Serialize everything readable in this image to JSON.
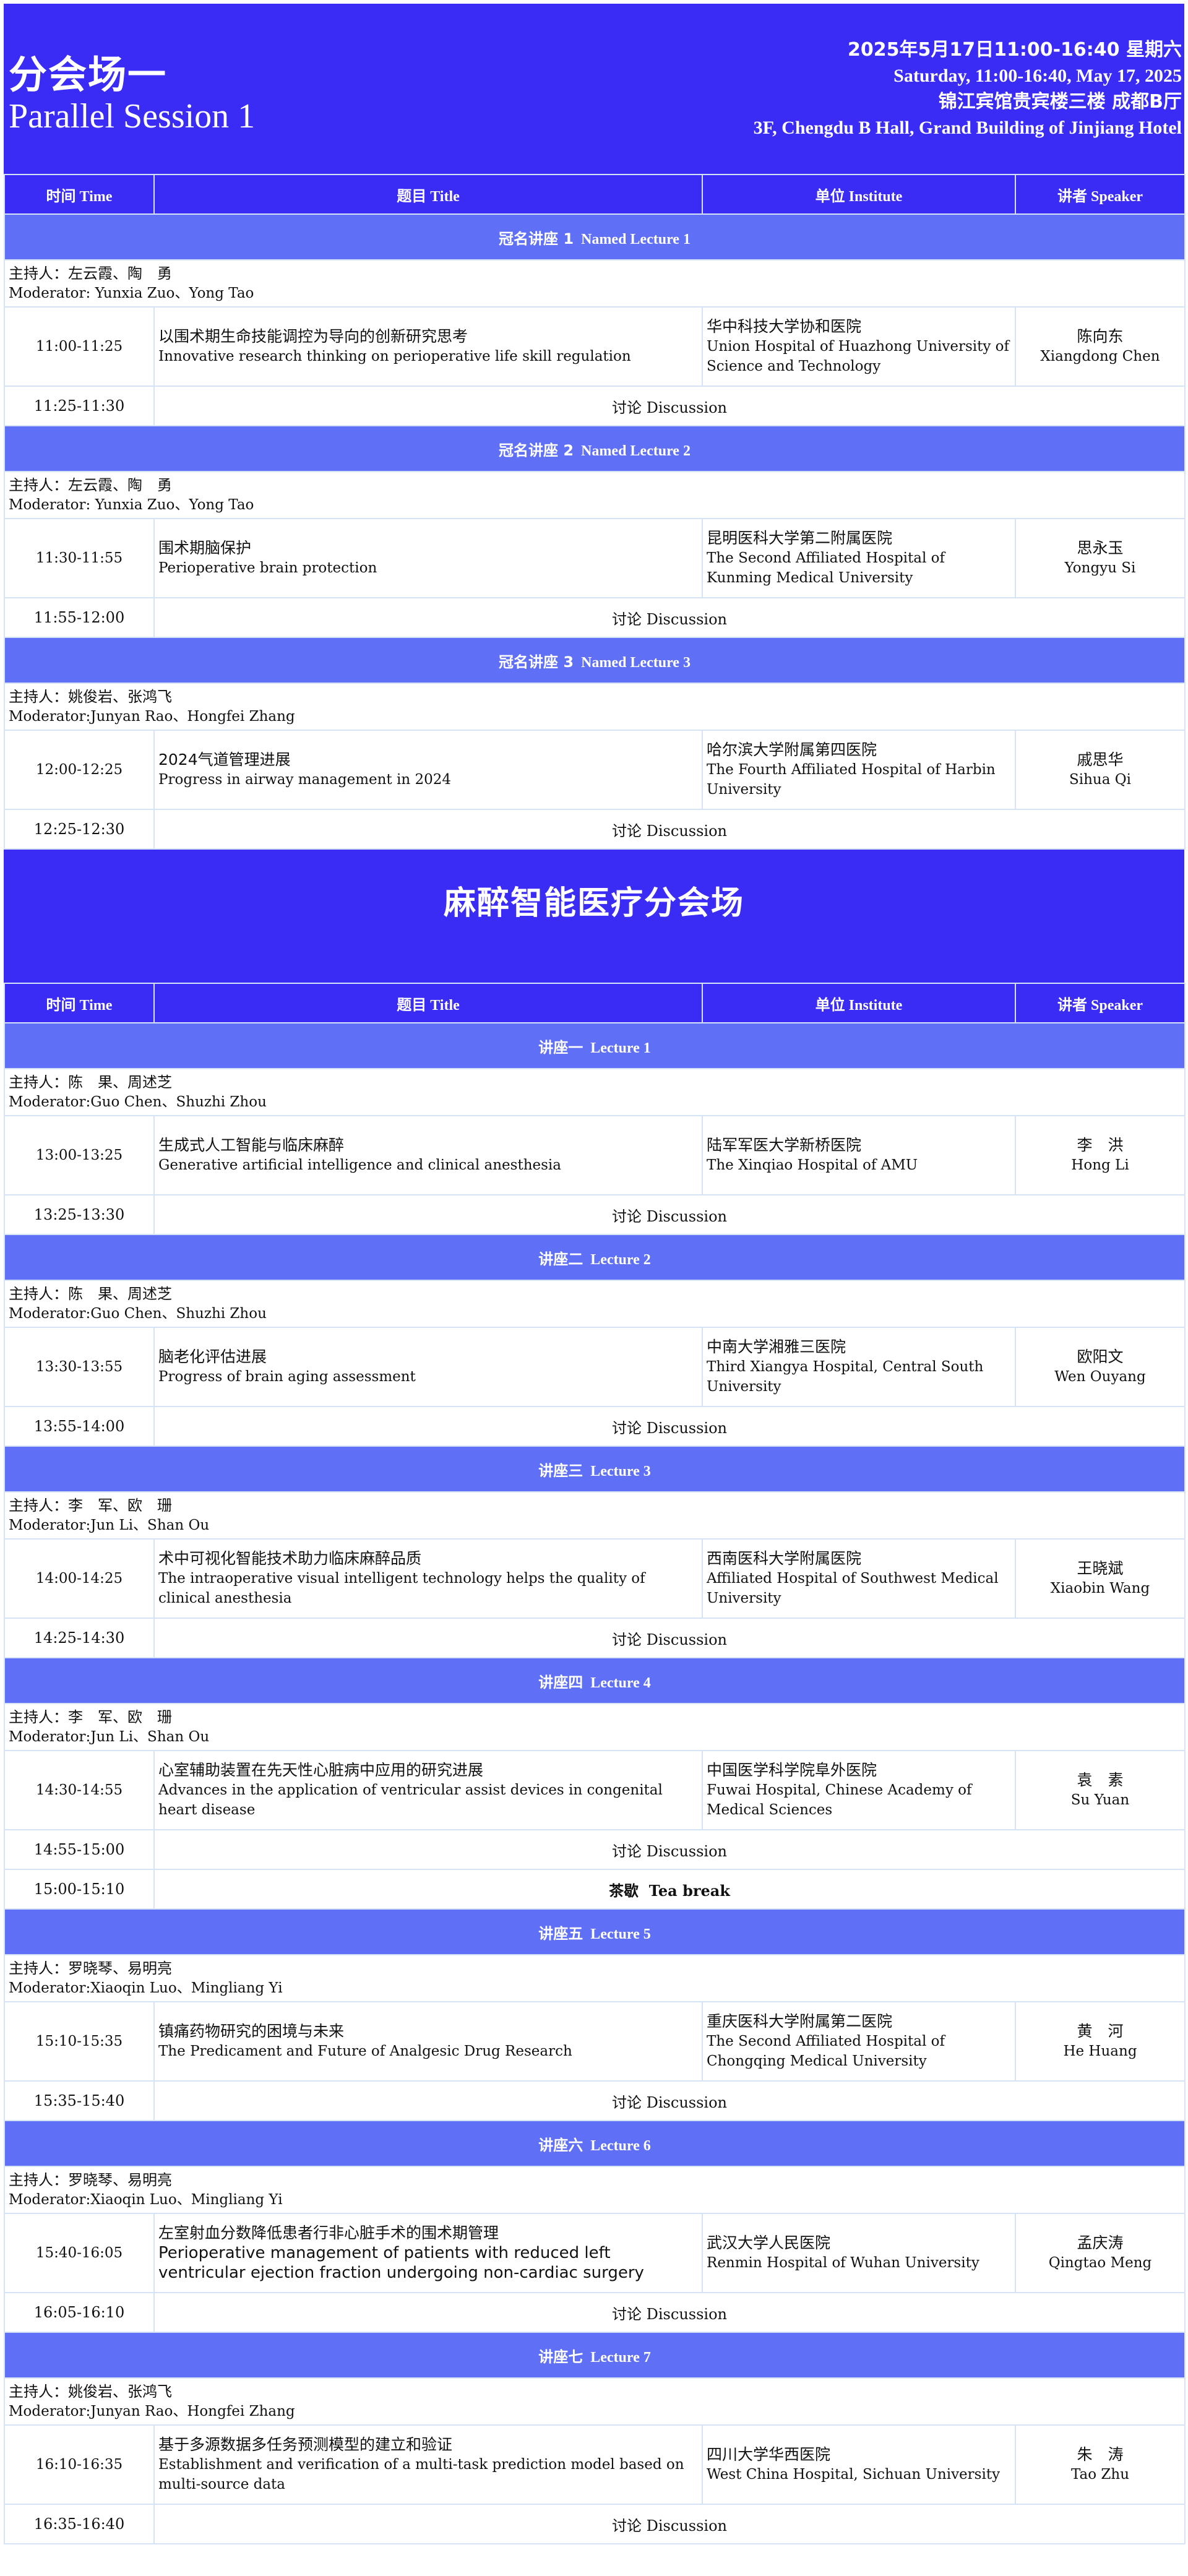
{
  "session1": {
    "title_zh": "分会场一",
    "title_en": "Parallel Session 1",
    "date_zh": "2025年5月17日11:00-16:40  星期六",
    "date_en": "Saturday, 11:00-16:40, May 17, 2025",
    "venue_zh": "锦江宾馆贵宾楼三楼 成都B厅",
    "venue_en": "3F, Chengdu B Hall, Grand Building of Jinjiang Hotel"
  },
  "headers": {
    "time_zh": "时间",
    "time_en": "Time",
    "title_zh": "题目",
    "title_en": "Title",
    "inst_zh": "单位",
    "inst_en": "Institute",
    "spk_zh": "讲者",
    "spk_en": "Speaker"
  },
  "sections1": [
    {
      "lecture_zh": "冠名讲座 1",
      "lecture_en": "Named Lecture 1",
      "mod_zh": "主持人：左云霞、陶　勇",
      "mod_en": "Moderator:  Yunxia Zuo、Yong Tao",
      "time": "11:00-11:25",
      "title_zh": "以围术期生命技能调控为导向的创新研究思考",
      "title_en": "Innovative research thinking on perioperative life skill regulation",
      "inst_zh": "华中科技大学协和医院",
      "inst_en": "Union Hospital of Huazhong University of Science and Technology",
      "spk_zh": "陈向东",
      "spk_en": "Xiangdong Chen",
      "disc_time": "11:25-11:30",
      "disc_zh": "讨论",
      "disc_en": "Discussion"
    },
    {
      "lecture_zh": "冠名讲座 2",
      "lecture_en": "Named Lecture 2",
      "mod_zh": "主持人：左云霞、陶　勇",
      "mod_en": "Moderator:  Yunxia Zuo、Yong Tao",
      "time": "11:30-11:55",
      "title_zh": "围术期脑保护",
      "title_en": "Perioperative brain protection",
      "inst_zh": "昆明医科大学第二附属医院",
      "inst_en": "The Second Affiliated Hospital of Kunming Medical University",
      "spk_zh": "思永玉",
      "spk_en": "Yongyu Si",
      "disc_time": "11:55-12:00",
      "disc_zh": "讨论",
      "disc_en": "Discussion"
    },
    {
      "lecture_zh": "冠名讲座 3",
      "lecture_en": "Named Lecture 3",
      "mod_zh": "主持人：姚俊岩、张鸿飞",
      "mod_en": "Moderator:Junyan Rao、Hongfei Zhang",
      "time": "12:00-12:25",
      "title_zh": "2024气道管理进展",
      "title_en": "Progress in airway management in 2024",
      "inst_zh": "哈尔滨大学附属第四医院",
      "inst_en": "The Fourth Affiliated Hospital of Harbin University",
      "spk_zh": "戚思华",
      "spk_en": "Sihua  Qi",
      "disc_time": "12:25-12:30",
      "disc_zh": "讨论",
      "disc_en": "Discussion"
    }
  ],
  "session2": {
    "title_zh": "麻醉智能医疗分会场"
  },
  "sections2": [
    {
      "lecture_zh": "讲座一",
      "lecture_en": "Lecture 1",
      "mod_zh": "主持人：陈　果、周述芝",
      "mod_en": "Moderator:Guo Chen、Shuzhi Zhou",
      "time": "13:00-13:25",
      "title_zh": "生成式人工智能与临床麻醉",
      "title_en": "Generative artificial intelligence and clinical anesthesia",
      "inst_zh": "陆军军医大学新桥医院",
      "inst_en": "The Xinqiao Hospital of AMU",
      "spk_zh": "李　洪",
      "spk_en": "Hong  Li",
      "disc_time": "13:25-13:30",
      "disc_zh": "讨论",
      "disc_en": "Discussion"
    },
    {
      "lecture_zh": "讲座二",
      "lecture_en": "Lecture 2",
      "mod_zh": "主持人：陈　果、周述芝",
      "mod_en": "Moderator:Guo Chen、Shuzhi Zhou",
      "time": "13:30-13:55",
      "title_zh": "脑老化评估进展",
      "title_en": "Progress of brain aging assessment",
      "inst_zh": "中南大学湘雅三医院",
      "inst_en": "Third Xiangya Hospital, Central South University",
      "spk_zh": "欧阳文",
      "spk_en": "Wen Ouyang",
      "disc_time": "13:55-14:00",
      "disc_zh": "讨论",
      "disc_en": "Discussion"
    },
    {
      "lecture_zh": "讲座三",
      "lecture_en": "Lecture 3",
      "mod_zh": "主持人：李　军、欧　珊",
      "mod_en": "Moderator:Jun Li、Shan Ou",
      "time": "14:00-14:25",
      "title_zh": "术中可视化智能技术助力临床麻醉品质",
      "title_en": "The intraoperative visual intelligent technology helps the quality of clinical anesthesia",
      "inst_zh": "西南医科大学附属医院",
      "inst_en": "Affiliated Hospital of Southwest Medical University",
      "spk_zh": "王晓斌",
      "spk_en": "Xiaobin Wang",
      "disc_time": "14:25-14:30",
      "disc_zh": "讨论",
      "disc_en": "Discussion"
    },
    {
      "lecture_zh": "讲座四",
      "lecture_en": "Lecture 4",
      "mod_zh": "主持人：李　军、欧　珊",
      "mod_en": "Moderator:Jun Li、Shan Ou",
      "time": "14:30-14:55",
      "title_zh": "心室辅助装置在先天性心脏病中应用的研究进展",
      "title_en": "Advances in the application of ventricular assist devices in congenital heart disease",
      "inst_zh": "中国医学科学院阜外医院",
      "inst_en": "Fuwai Hospital, Chinese Academy of Medical Sciences",
      "spk_zh": "袁　素",
      "spk_en": "Su Yuan",
      "disc_time": "14:55-15:00",
      "disc_zh": "讨论",
      "disc_en": "Discussion",
      "break_time": "15:00-15:10",
      "break_zh": "茶歇",
      "break_en": "Tea break"
    },
    {
      "lecture_zh": "讲座五",
      "lecture_en": "Lecture 5",
      "mod_zh": "主持人：罗晓琴、易明亮",
      "mod_en": "Moderator:Xiaoqin Luo、Mingliang Yi",
      "time": "15:10-15:35",
      "title_zh": "镇痛药物研究的困境与未来",
      "title_en": "The Predicament and Future of Analgesic Drug Research",
      "inst_zh": "重庆医科大学附属第二医院",
      "inst_en": "The Second Affiliated Hospital of Chongqing Medical University",
      "spk_zh": "黄　河",
      "spk_en": "He Huang",
      "disc_time": "15:35-15:40",
      "disc_zh": "讨论",
      "disc_en": "Discussion"
    },
    {
      "lecture_zh": "讲座六",
      "lecture_en": "Lecture 6",
      "mod_zh": "主持人：罗晓琴、易明亮",
      "mod_en": "Moderator:Xiaoqin Luo、Mingliang Yi",
      "time": "15:40-16:05",
      "title_zh": "左室射血分数降低患者行非心脏手术的围术期管理",
      "title_en": "Perioperative management of patients with reduced left ventricular ejection fraction undergoing non-cardiac surgery",
      "title_en_big": true,
      "inst_zh": "武汉大学人民医院",
      "inst_en": "Renmin Hospital of Wuhan University",
      "spk_zh": "孟庆涛",
      "spk_en": "Qingtao Meng",
      "disc_time": "16:05-16:10",
      "disc_zh": "讨论",
      "disc_en": "Discussion"
    },
    {
      "lecture_zh": "讲座七",
      "lecture_en": "Lecture 7",
      "mod_zh": "主持人：姚俊岩、张鸿飞",
      "mod_en": "Moderator:Junyan Rao、Hongfei Zhang",
      "time": "16:10-16:35",
      "title_zh": "基于多源数据多任务预测模型的建立和验证",
      "title_en": "Establishment and verification of a multi-task prediction model based on multi-source data",
      "inst_zh": "四川大学华西医院",
      "inst_en": "West China Hospital, Sichuan University",
      "spk_zh": "朱　涛",
      "spk_en": "Tao Zhu",
      "disc_time": "16:35-16:40",
      "disc_zh": "讨论",
      "disc_en": "Discussion"
    }
  ],
  "colors": {
    "primary": "#3a2cf5",
    "lecture_bar": "#5f6ff6",
    "grid": "#d6e2f5"
  }
}
